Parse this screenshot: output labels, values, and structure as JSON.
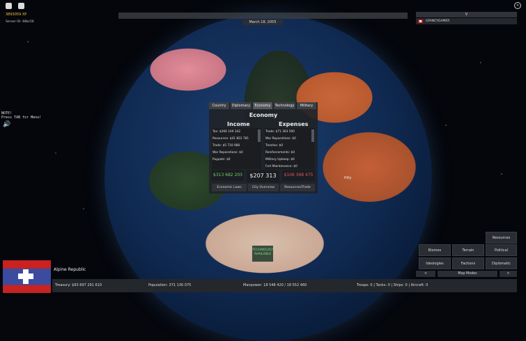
{
  "hud": {
    "xp": "3893059 XP",
    "server_id": "Server ID: 48bc56",
    "date": "March 18, 2055",
    "note": "NOTE!\nPress TAB for Menu!",
    "player_list_toggle": "V",
    "players": [
      {
        "name": "GFANCYGAMER"
      }
    ]
  },
  "map_label": "Hilly",
  "panel": {
    "tabs": [
      "Country",
      "Diplomacy",
      "Economy",
      "Technology",
      "Military"
    ],
    "active_tab": "Economy",
    "title": "Economy",
    "income_title": "Income",
    "expenses_title": "Expenses",
    "income_lines": [
      "Tax: $266 149 342",
      "Resources: $41 822 781",
      "Trade: $5 710 080",
      "War Reparations: $0",
      "Puppets: $0"
    ],
    "expense_lines": [
      "Trade: $71 303 500",
      "War Reparations: $0",
      "Treaties: $0",
      "Reinforcements: $0",
      "Military Upkeep: $0",
      "Fort Maintenance: $0"
    ],
    "income_total": "$313 682 203",
    "net": "$207 313 728",
    "expenses_total": "$106 368 475",
    "buttons": [
      "Economic Laws",
      "City Overview",
      "Resources/Trade"
    ]
  },
  "technology_notice": "TECHNOLOGY AVAILABLE",
  "map_mode_buttons": {
    "resources": "Resources",
    "biomes": "Biomes",
    "terrain": "Terrain",
    "political": "Political",
    "ideologies": "Ideologies",
    "factions": "Factions",
    "diplomatic": "Diplomatic",
    "prev": "<",
    "map_modes": "Map Modes",
    "next": ">"
  },
  "country": {
    "name": "Alpine Republic",
    "treasury": "Treasury:   $93 697 291 610",
    "population": "Population: 371 130 075",
    "manpower": "Manpower:   18 548 420   /  18 552 460",
    "units": "Troops: 0   |   Tanks: 0   |   Ships: 0   |   Aircraft: 0"
  },
  "colors": {
    "panel_bg": "#202328",
    "income_green": "#6fd36f",
    "expense_red": "#e05a5a",
    "xp_gold": "#f0c040"
  }
}
